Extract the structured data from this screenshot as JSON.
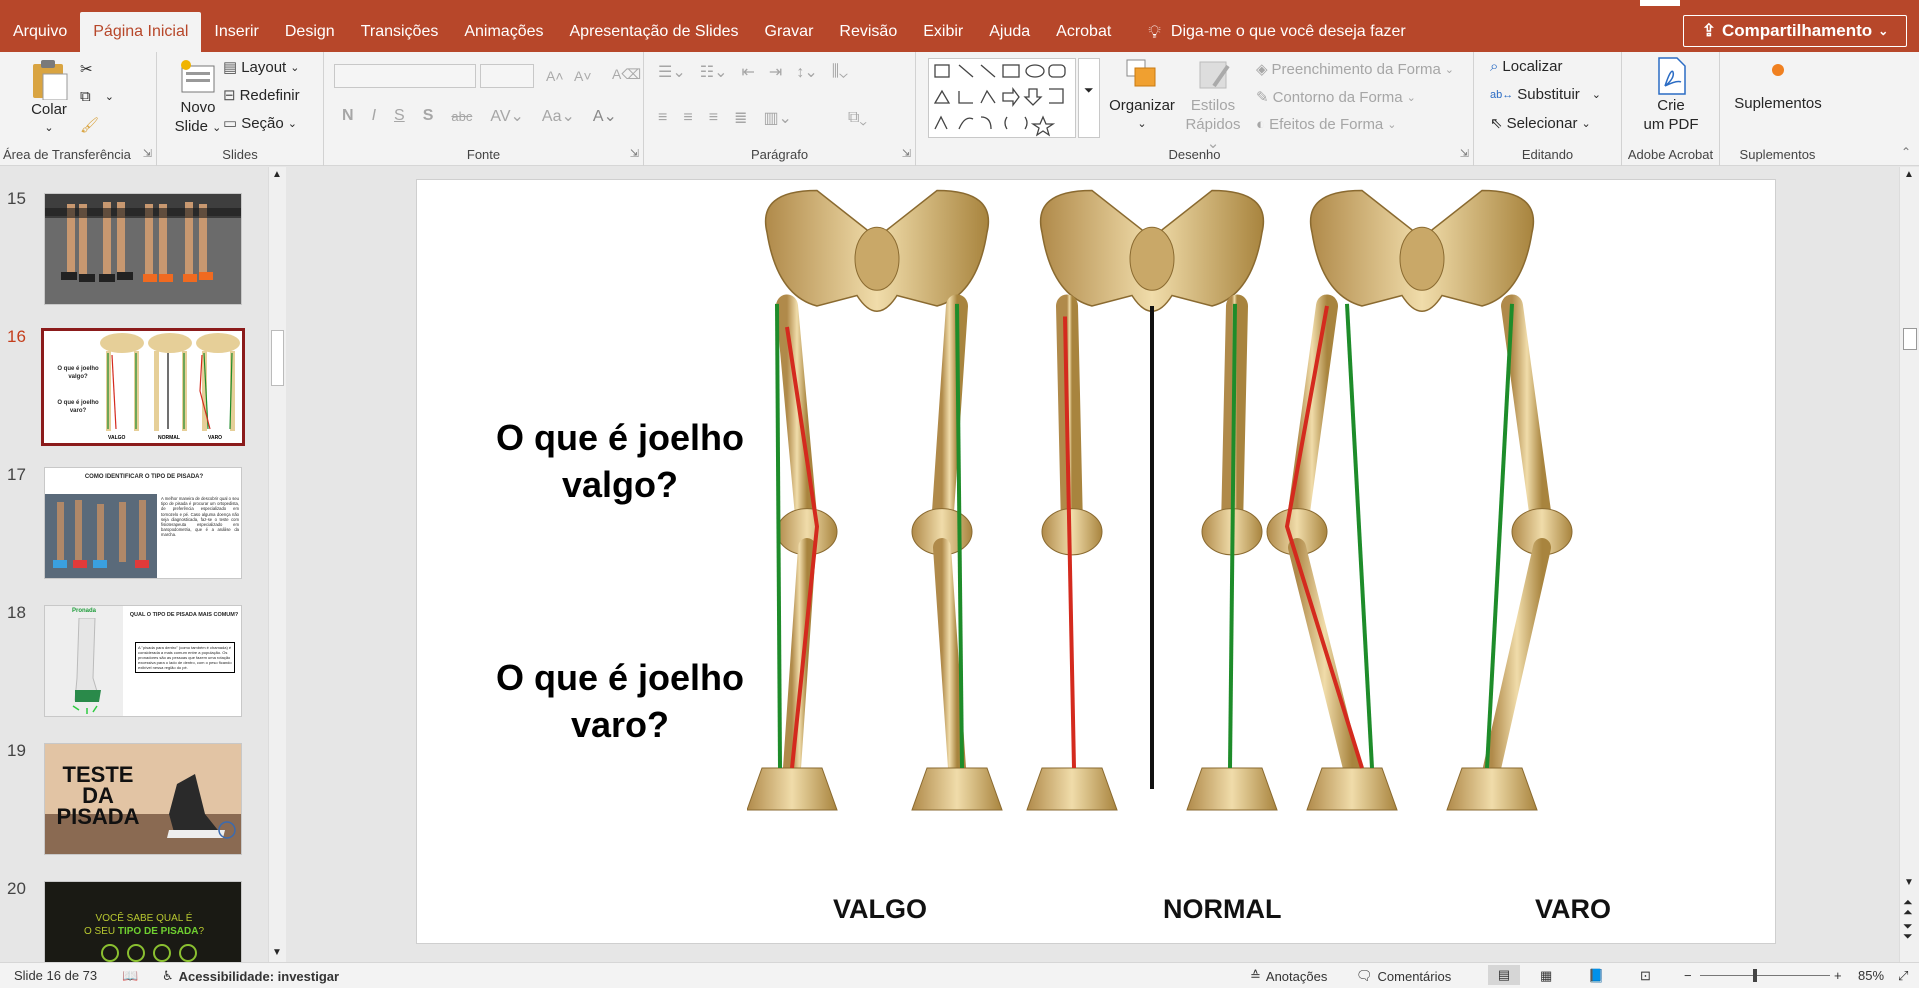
{
  "menu": {
    "tabs": [
      "Arquivo",
      "Página Inicial",
      "Inserir",
      "Design",
      "Transições",
      "Animações",
      "Apresentação de Slides",
      "Gravar",
      "Revisão",
      "Exibir",
      "Ajuda",
      "Acrobat"
    ],
    "active_tab": "Página Inicial",
    "tell_me": "Diga-me o que você deseja fazer",
    "share": "Compartilhamento",
    "accent": "#b7472a"
  },
  "ribbon": {
    "clipboard": {
      "paste": "Colar",
      "label": "Área de Transferência"
    },
    "slides": {
      "new_slide_1": "Novo",
      "new_slide_2": "Slide",
      "layout": "Layout",
      "reset": "Redefinir",
      "section": "Seção",
      "label": "Slides"
    },
    "font": {
      "label": "Fonte",
      "bold": "N",
      "italic": "I",
      "underline": "S",
      "shadow": "S",
      "strike": "abc",
      "spacing": "AV",
      "case": "Aa",
      "color": "A"
    },
    "paragraph": {
      "label": "Parágrafo"
    },
    "drawing": {
      "arrange": "Organizar",
      "quick_styles_1": "Estilos",
      "quick_styles_2": "Rápidos",
      "fill": "Preenchimento da Forma",
      "outline": "Contorno da Forma",
      "effects": "Efeitos de Forma",
      "label": "Desenho"
    },
    "editing": {
      "find": "Localizar",
      "replace": "Substituir",
      "select": "Selecionar",
      "label": "Editando"
    },
    "acrobat": {
      "create_1": "Crie",
      "create_2": "um PDF",
      "label": "Adobe Acrobat"
    },
    "addins": {
      "button": "Suplementos",
      "label": "Suplementos"
    }
  },
  "thumbnails": [
    {
      "num": "15"
    },
    {
      "num": "16",
      "q1": "O que é joelho valgo?",
      "q2": "O que é joelho varo?",
      "l1": "VALGO",
      "l2": "NORMAL",
      "l3": "VARO"
    },
    {
      "num": "17",
      "title": "COMO IDENTIFICAR O TIPO DE PISADA?",
      "body": "A melhor maneira de descobrir qual o seu tipo de pisada é procurar um ortopedista, de preferência especializado em tornozelo e pé. Caso alguma doença não seja diagnosticada, faz-se o teste com fisioterapeuta especializado em baropodometria, que é a análise da marcha."
    },
    {
      "num": "18",
      "tag": "Pronada",
      "title": "QUAL O TIPO DE PISADA MAIS COMUM?",
      "body": "A \"pisada para dentro\" (como também é chamada) é considerada a mais comum entre a população. Os pronadores são as pessoas que fazem uma rotação excessiva para o lado de dentro, com o peso ficando exibível nessa região do pé."
    },
    {
      "num": "19",
      "title_1": "TESTE",
      "title_2": "DA",
      "title_3": "PISADA"
    },
    {
      "num": "20",
      "line_1": "VOCÊ SABE QUAL É",
      "line_2a": "O SEU ",
      "line_2b": "TIPO DE PISADA",
      "line_2c": "?"
    }
  ],
  "slide": {
    "question_1": "O que é joelho valgo?",
    "question_2": "O que é joelho varo?",
    "label_valgo": "VALGO",
    "label_normal": "NORMAL",
    "label_varo": "VARO",
    "bone_color": "#e8d4a0",
    "red_line": "#d42a1e",
    "green_line": "#1e8c2a"
  },
  "status": {
    "slide_info": "Slide 16 de 73",
    "accessibility": "Acessibilidade: investigar",
    "notes": "Anotações",
    "comments": "Comentários",
    "zoom": "85%",
    "zoom_level": 0.85
  }
}
